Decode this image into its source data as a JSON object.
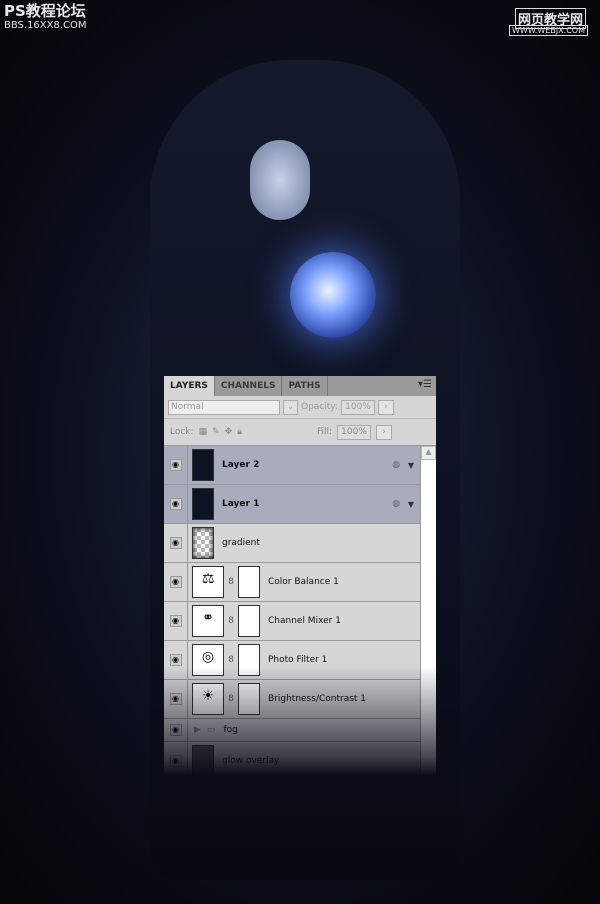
{
  "watermarks": {
    "left_title": "PS教程论坛",
    "left_url": "BBS.16XX8.COM",
    "right_title": "网页教学网",
    "right_url": "WWW.WEBJX.COM"
  },
  "panel": {
    "tabs": [
      {
        "label": "LAYERS",
        "active": true
      },
      {
        "label": "CHANNELS"
      },
      {
        "label": "PATHS"
      }
    ],
    "menu_icon": "panel-menu-icon",
    "blend_mode": "Normal",
    "opacity_label": "Opacity:",
    "opacity": "100%",
    "lock_label": "Lock:",
    "fill_label": "Fill:",
    "fill": "100%",
    "layers": [
      {
        "name": "Layer 2",
        "selected": true,
        "type": "smart-object"
      },
      {
        "name": "Layer 1",
        "selected": true,
        "type": "smart-object"
      },
      {
        "name": "gradient",
        "type": "pixel"
      },
      {
        "name": "Color Balance 1",
        "type": "adjustment",
        "icon": "scales-icon"
      },
      {
        "name": "Channel Mixer 1",
        "type": "adjustment",
        "icon": "circles-icon"
      },
      {
        "name": "Photo Filter 1",
        "type": "adjustment",
        "icon": "camera-icon"
      },
      {
        "name": "Brightness/Contrast 1",
        "type": "adjustment",
        "icon": "sun-icon"
      },
      {
        "name": "fog",
        "type": "group"
      },
      {
        "name": "glow overlay",
        "type": "pixel"
      }
    ]
  }
}
